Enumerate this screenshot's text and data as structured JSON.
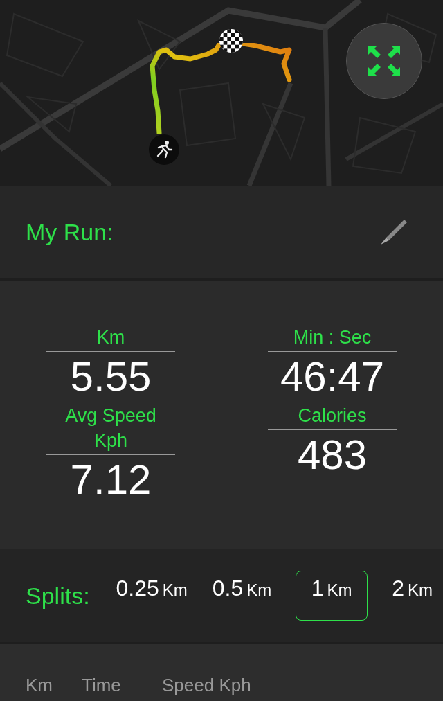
{
  "run": {
    "title": "My Run:"
  },
  "stats": [
    {
      "label": "Km",
      "value": "5.55"
    },
    {
      "label": "Min : Sec",
      "value": "46:47"
    },
    {
      "label": "Avg Speed Kph",
      "value": "7.12"
    },
    {
      "label": "Calories",
      "value": "483"
    }
  ],
  "splits": {
    "label": "Splits:",
    "options": [
      {
        "value": "0.25",
        "unit": "Km",
        "selected": false
      },
      {
        "value": "0.5",
        "unit": "Km",
        "selected": false
      },
      {
        "value": "1",
        "unit": "Km",
        "selected": true
      },
      {
        "value": "2",
        "unit": "Km",
        "selected": false
      }
    ]
  },
  "table": {
    "columns": [
      "Km",
      "Time",
      "Speed Kph"
    ]
  }
}
